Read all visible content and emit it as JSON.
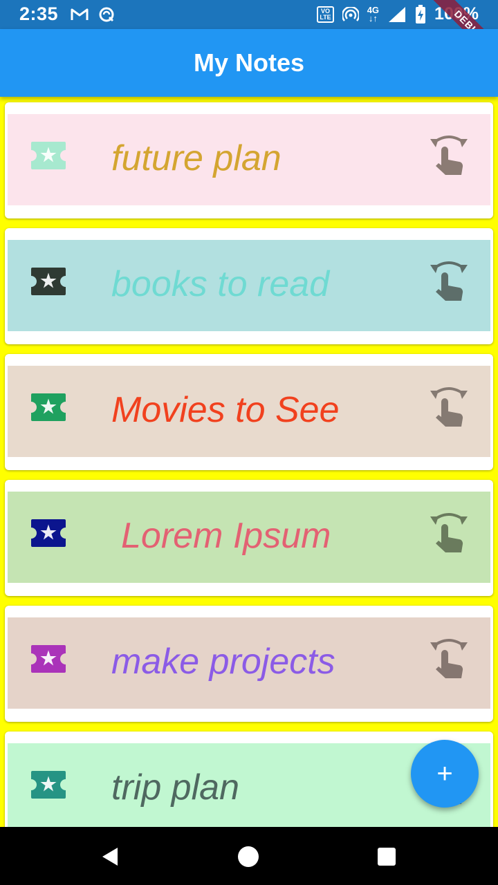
{
  "status": {
    "time": "2:35",
    "left_icons": [
      "gmail-icon",
      "sync-icon"
    ],
    "volte_top": "VO",
    "volte_bottom": "LTE",
    "network": "4G",
    "right_icons": [
      "hotspot-icon",
      "signal-icon",
      "battery-charging-icon"
    ],
    "battery": "100%",
    "debug_banner": "DEBUG"
  },
  "app_bar": {
    "title": "My Notes"
  },
  "notes": [
    {
      "title": "future plan",
      "bg": "#fce4ec",
      "icon_color": "#a7e9cf",
      "text_color": "#d4a531",
      "gesture_color": "#8b7b74"
    },
    {
      "title": "books to read",
      "bg": "#b2e0e0",
      "icon_color": "#2f3a33",
      "text_color": "#6fdad2",
      "gesture_color": "#5d6e6a"
    },
    {
      "title": "Movies to See",
      "bg": "#e8dacd",
      "icon_color": "#1fa15f",
      "text_color": "#f1411e",
      "gesture_color": "#857a72"
    },
    {
      "title": "Lorem Ipsum",
      "bg": "#c5e4b3",
      "icon_color": "#0b158e",
      "text_color": "#e36173",
      "gesture_color": "#6a7b5d"
    },
    {
      "title": "make projects",
      "bg": "#e5d3c9",
      "icon_color": "#aa33b9",
      "text_color": "#8b5be6",
      "gesture_color": "#857670"
    },
    {
      "title": "trip plan",
      "bg": "#c1f7d1",
      "icon_color": "#269484",
      "text_color": "#4f6860",
      "gesture_color": "#6b8f80"
    }
  ],
  "fab": {
    "label": "+",
    "color": "#2196f3"
  },
  "nav": [
    "back-icon",
    "home-icon",
    "recents-icon"
  ]
}
